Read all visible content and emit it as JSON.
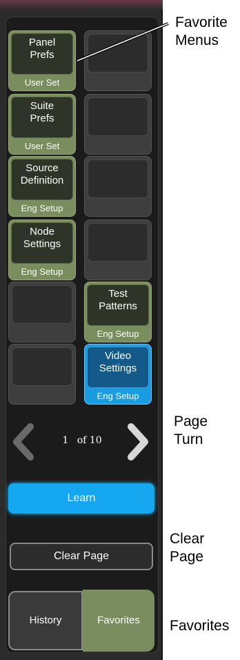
{
  "panel": {
    "favorite_buttons": [
      {
        "title_lines": [
          "Panel",
          "Prefs"
        ],
        "subtitle": "User Set",
        "style": "green"
      },
      {
        "title_lines": [],
        "subtitle": "",
        "style": "empty"
      },
      {
        "title_lines": [
          "Suite",
          "Prefs"
        ],
        "subtitle": "User Set",
        "style": "green"
      },
      {
        "title_lines": [],
        "subtitle": "",
        "style": "empty"
      },
      {
        "title_lines": [
          "Source",
          "Definition"
        ],
        "subtitle": "Eng  Setup",
        "style": "green"
      },
      {
        "title_lines": [],
        "subtitle": "",
        "style": "empty"
      },
      {
        "title_lines": [
          "Node",
          "Settings"
        ],
        "subtitle": "Eng  Setup",
        "style": "green"
      },
      {
        "title_lines": [],
        "subtitle": "",
        "style": "empty"
      },
      {
        "title_lines": [],
        "subtitle": "",
        "style": "empty"
      },
      {
        "title_lines": [
          "Test",
          "Patterns"
        ],
        "subtitle": "Eng  Setup",
        "style": "green"
      },
      {
        "title_lines": [],
        "subtitle": "",
        "style": "empty"
      },
      {
        "title_lines": [
          "Video",
          "Settings"
        ],
        "subtitle": "Eng  Setup",
        "style": "blue"
      }
    ],
    "pager": {
      "current": "1",
      "of_label": "of",
      "total": "10"
    },
    "learn_label": "Learn",
    "clear_page_label": "Clear Page",
    "history_label": "History",
    "favorites_label": "Favorites"
  },
  "callouts": {
    "favorite_menus": [
      "Favorite",
      "Menus"
    ],
    "page_turn": [
      "Page",
      "Turn"
    ],
    "clear_page": [
      "Clear",
      "Page"
    ],
    "favorites": [
      "Favorites"
    ]
  },
  "colors": {
    "favorite_green": "#7a8d5e",
    "active_blue": "#1b9be0",
    "learn_blue": "#14a6ee"
  }
}
